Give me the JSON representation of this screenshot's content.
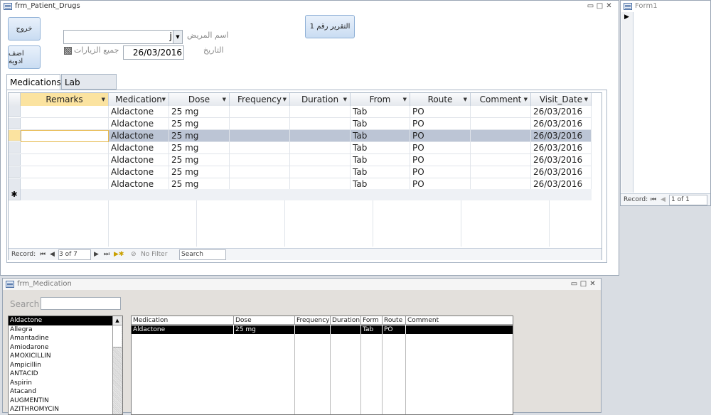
{
  "patient_form": {
    "title": "frm_Patient_Drugs",
    "exit_button": "خروج",
    "add_drugs_button": "اضف ادوية",
    "report_button": "التقرير رقم 1",
    "patient_name_label": "اسم المريض",
    "patient_name_value": "j",
    "date_label": "التاريخ",
    "date_value": "26/03/2016",
    "all_visits_label": "جميع الزيارات",
    "tabs": [
      "Medications",
      "Lab Reports"
    ],
    "columns": [
      "Remarks",
      "Medication",
      "Dose",
      "Frequency",
      "Duration",
      "From",
      "Route",
      "Comment",
      "Visit_Date"
    ],
    "rows": [
      [
        "",
        "Aldactone",
        "25 mg",
        "",
        "",
        "Tab",
        "PO",
        "",
        "26/03/2016"
      ],
      [
        "",
        "Aldactone",
        "25 mg",
        "",
        "",
        "Tab",
        "PO",
        "",
        "26/03/2016"
      ],
      [
        "",
        "Aldactone",
        "25 mg",
        "",
        "",
        "Tab",
        "PO",
        "",
        "26/03/2016"
      ],
      [
        "",
        "Aldactone",
        "25 mg",
        "",
        "",
        "Tab",
        "PO",
        "",
        "26/03/2016"
      ],
      [
        "",
        "Aldactone",
        "25 mg",
        "",
        "",
        "Tab",
        "PO",
        "",
        "26/03/2016"
      ],
      [
        "",
        "Aldactone",
        "25 mg",
        "",
        "",
        "Tab",
        "PO",
        "",
        "26/03/2016"
      ],
      [
        "",
        "Aldactone",
        "25 mg",
        "",
        "",
        "Tab",
        "PO",
        "",
        "26/03/2016"
      ]
    ],
    "new_record_marker": "✱",
    "nav": {
      "record_label": "Record:",
      "position": "3 of 7",
      "filter": "No Filter",
      "search": "Search"
    }
  },
  "form1": {
    "title": "Form1",
    "nav": {
      "record_label": "Record:",
      "position": "1 of 1"
    }
  },
  "medication_form": {
    "title": "frm_Medication",
    "search_label": "Search",
    "search_value": "",
    "drug_list": [
      "Aldactone",
      "Allegra",
      "Amantadine",
      "Amiodarone",
      "AMOXICILLIN",
      "Ampicillin",
      "ANTACID",
      "Aspirin",
      "Atacand",
      "AUGMENTIN",
      "AZITHROMYCIN"
    ],
    "sub_columns": [
      "Medication",
      "Dose",
      "Frequency",
      "Duration",
      "Form",
      "Route",
      "Comment"
    ],
    "sub_row": [
      "Aldactone",
      "25 mg",
      "",
      "",
      "Tab",
      "PO",
      ""
    ]
  },
  "window_controls": [
    "▭",
    "□",
    "✕"
  ],
  "colors": {
    "selected_row": "#bcc5d5",
    "active_header": "#fbe3a0",
    "accent": "#000000"
  }
}
